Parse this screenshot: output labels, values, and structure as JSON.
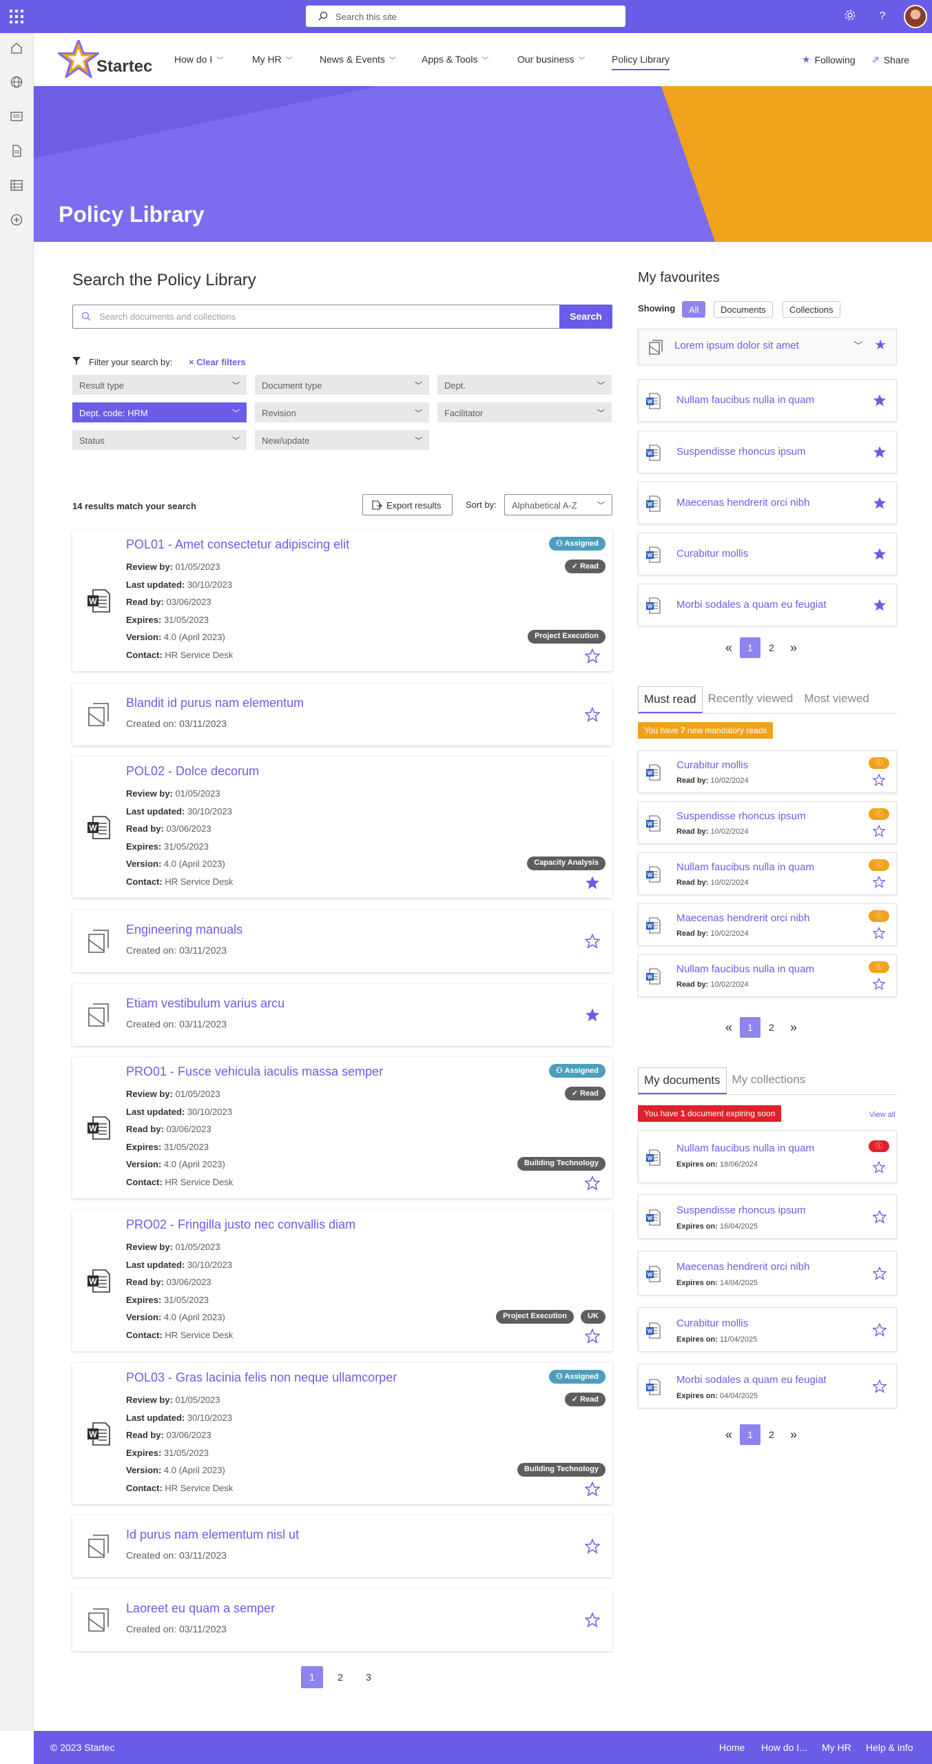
{
  "topbar": {
    "search_placeholder": "Search this site"
  },
  "site": {
    "logo_text": "Startec"
  },
  "nav": [
    {
      "label": "How do I"
    },
    {
      "label": "My HR"
    },
    {
      "label": "News & Events"
    },
    {
      "label": "Apps & Tools"
    },
    {
      "label": "Our business"
    },
    {
      "label": "Policy Library"
    }
  ],
  "header_actions": {
    "following": "Following",
    "share": "Share"
  },
  "hero": {
    "title": "Policy Library"
  },
  "search": {
    "title": "Search the Policy Library",
    "placeholder": "Search documents and collections",
    "button": "Search",
    "filter_label": "Filter your search by:",
    "clear_filters": "Clear filters"
  },
  "filters": [
    "Result type",
    "Document type",
    "Dept.",
    "Dept. code: HRM",
    "Revision",
    "Facilitator",
    "Status",
    "New/update"
  ],
  "results": {
    "count_text": "14 results match your search",
    "export": "Export results",
    "sort_label": "Sort by:",
    "sort_value": "Alphabetical A-Z"
  },
  "labels": {
    "review_by": "Review by:",
    "last_updated": "Last updated:",
    "read_by": "Read by:",
    "expires": "Expires:",
    "version": "Version:",
    "contact": "Contact:",
    "created_on": "Created on:",
    "assigned": "Assigned",
    "read": "Read"
  },
  "cards": [
    {
      "title": "POL01 - Amet consectetur adipiscing elit",
      "review_by": "01/05/2023",
      "last_updated": "30/10/2023",
      "read_by": "03/06/2023",
      "expires": "31/05/2023",
      "version": "4.0 (April 2023)",
      "contact": "HR Service Desk",
      "tag": "Project Execution"
    },
    {
      "title": "Blandit id purus nam elementum",
      "created_on": "03/11/2023"
    },
    {
      "title": "POL02 - Dolce decorum",
      "review_by": "01/05/2023",
      "last_updated": "30/10/2023",
      "read_by": "03/06/2023",
      "expires": "31/05/2023",
      "version": "4.0 (April 2023)",
      "contact": "HR Service Desk",
      "tag": "Capacity Analysis"
    },
    {
      "title": "Engineering manuals",
      "created_on": "03/11/2023"
    },
    {
      "title": "Etiam vestibulum varius arcu",
      "created_on": "03/11/2023"
    },
    {
      "title": "PRO01 - Fusce vehicula iaculis massa semper",
      "review_by": "01/05/2023",
      "last_updated": "30/10/2023",
      "read_by": "03/06/2023",
      "expires": "31/05/2023",
      "version": "4.0 (April 2023)",
      "contact": "HR Service Desk",
      "tag": "Building Technology"
    },
    {
      "title": "PRO02 - Fringilla justo nec convallis diam",
      "review_by": "01/05/2023",
      "last_updated": "30/10/2023",
      "read_by": "03/06/2023",
      "expires": "31/05/2023",
      "version": "4.0 (April 2023)",
      "contact": "HR Service Desk",
      "tag": "Project Execution",
      "tag2": "UK"
    },
    {
      "title": "POL03 - Gras lacinia felis non neque ullamcorper",
      "review_by": "01/05/2023",
      "last_updated": "30/10/2023",
      "read_by": "03/06/2023",
      "expires": "31/05/2023",
      "version": "4.0 (April 2023)",
      "contact": "HR Service Desk",
      "tag": "Building Technology"
    },
    {
      "title": "Id purus nam elementum nisl ut",
      "created_on": "03/11/2023"
    },
    {
      "title": "Laoreet eu quam a semper",
      "created_on": "03/11/2023"
    }
  ],
  "results_pager": [
    "1",
    "2",
    "3"
  ],
  "favourites": {
    "title": "My favourites",
    "showing": "Showing",
    "chips": [
      "All",
      "Documents",
      "Collections"
    ],
    "collection": "Lorem ipsum dolor sit amet",
    "items": [
      "Nullam faucibus nulla in quam",
      "Suspendisse rhoncus ipsum",
      "Maecenas hendrerit orci nibh",
      "Curabitur mollis",
      "Morbi sodales a quam eu feugiat"
    ],
    "pager": [
      "1",
      "2"
    ]
  },
  "mustread": {
    "tabs": [
      "Must read",
      "Recently viewed",
      "Most viewed"
    ],
    "banner_pre": "You have ",
    "banner_num": "7",
    "banner_post": " new mandatory reads",
    "read_by_label": "Read by:",
    "items": [
      {
        "title": "Curabitur mollis",
        "date": "10/02/2024"
      },
      {
        "title": "Suspendisse rhoncus ipsum",
        "date": "10/02/2024"
      },
      {
        "title": "Nullam faucibus nulla in quam",
        "date": "10/02/2024"
      },
      {
        "title": "Maecenas hendrerit orci nibh",
        "date": "10/02/2024"
      },
      {
        "title": "Nullam faucibus nulla in quam",
        "date": "10/02/2024"
      }
    ],
    "pager": [
      "1",
      "2"
    ]
  },
  "mydocs": {
    "tabs": [
      "My documents",
      "My collections"
    ],
    "banner_pre": "You have ",
    "banner_num": "1",
    "banner_post": " document expiring soon",
    "view_all": "View all",
    "expires_label": "Expires on:",
    "items": [
      {
        "title": "Nullam faucibus nulla in quam",
        "date": "18/06/2024"
      },
      {
        "title": "Suspendisse rhoncus ipsum",
        "date": "16/04/2025"
      },
      {
        "title": "Maecenas hendrerit orci nibh",
        "date": "14/04/2025"
      },
      {
        "title": "Curabitur mollis",
        "date": "11/04/2025"
      },
      {
        "title": "Morbi sodales a quam eu feugiat",
        "date": "04/04/2025"
      }
    ],
    "pager": [
      "1",
      "2"
    ]
  },
  "footer": {
    "copyright": "© 2023 Startec",
    "links": [
      "Home",
      "How do I...",
      "My HR",
      "Help & info"
    ]
  },
  "colors": {
    "accent": "#6b5ce7",
    "orange": "#f1a21d",
    "assigned": "#4c9fba",
    "alert_red": "#e0202a"
  }
}
